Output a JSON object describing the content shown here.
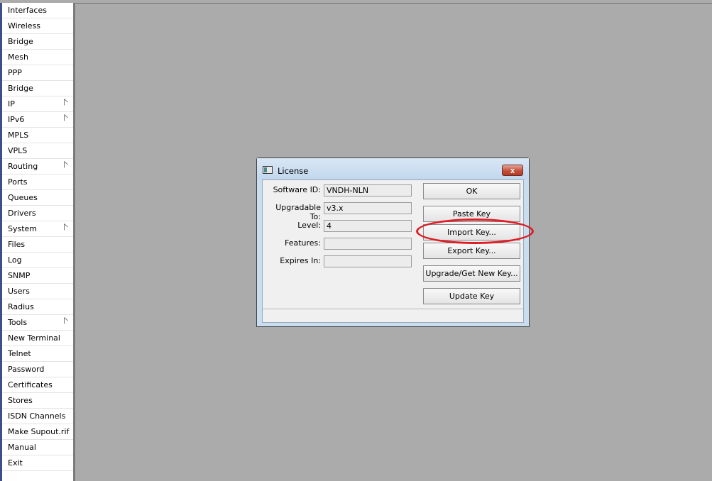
{
  "sidebar": {
    "items": [
      {
        "label": "Interfaces",
        "submenu": false
      },
      {
        "label": "Wireless",
        "submenu": false
      },
      {
        "label": "Bridge",
        "submenu": false
      },
      {
        "label": "Mesh",
        "submenu": false
      },
      {
        "label": "PPP",
        "submenu": false
      },
      {
        "label": "Bridge",
        "submenu": false
      },
      {
        "label": "IP",
        "submenu": true
      },
      {
        "label": "IPv6",
        "submenu": true
      },
      {
        "label": "MPLS",
        "submenu": false
      },
      {
        "label": "VPLS",
        "submenu": false
      },
      {
        "label": "Routing",
        "submenu": true
      },
      {
        "label": "Ports",
        "submenu": false
      },
      {
        "label": "Queues",
        "submenu": false
      },
      {
        "label": "Drivers",
        "submenu": false
      },
      {
        "label": "System",
        "submenu": true
      },
      {
        "label": "Files",
        "submenu": false
      },
      {
        "label": "Log",
        "submenu": false
      },
      {
        "label": "SNMP",
        "submenu": false
      },
      {
        "label": "Users",
        "submenu": false
      },
      {
        "label": "Radius",
        "submenu": false
      },
      {
        "label": "Tools",
        "submenu": true
      },
      {
        "label": "New Terminal",
        "submenu": false
      },
      {
        "label": "Telnet",
        "submenu": false
      },
      {
        "label": "Password",
        "submenu": false
      },
      {
        "label": "Certificates",
        "submenu": false
      },
      {
        "label": "Stores",
        "submenu": false
      },
      {
        "label": "ISDN Channels",
        "submenu": false
      },
      {
        "label": "Make Supout.rif",
        "submenu": false
      },
      {
        "label": "Manual",
        "submenu": false
      },
      {
        "label": "Exit",
        "submenu": false
      }
    ]
  },
  "dialog": {
    "title": "License",
    "close_label": "x",
    "fields": {
      "software_id": {
        "label": "Software ID:",
        "value": "VNDH-NLN"
      },
      "upgradable_to": {
        "label": "Upgradable To:",
        "value": "v3.x"
      },
      "level": {
        "label": "Level:",
        "value": "4"
      },
      "features": {
        "label": "Features:",
        "value": ""
      },
      "expires_in": {
        "label": "Expires In:",
        "value": ""
      }
    },
    "buttons": {
      "ok": "OK",
      "paste_key": "Paste Key",
      "import_key": "Import Key...",
      "export_key": "Export Key...",
      "upgrade": "Upgrade/Get New Key...",
      "update_key": "Update Key"
    },
    "status": ""
  },
  "colors": {
    "desktop": "#ababab",
    "highlight": "#e01c24",
    "close_button": "#c4503b"
  },
  "icons": {
    "submenu": "triangle-right-outline",
    "title": "window-icon",
    "close": "close-icon"
  }
}
